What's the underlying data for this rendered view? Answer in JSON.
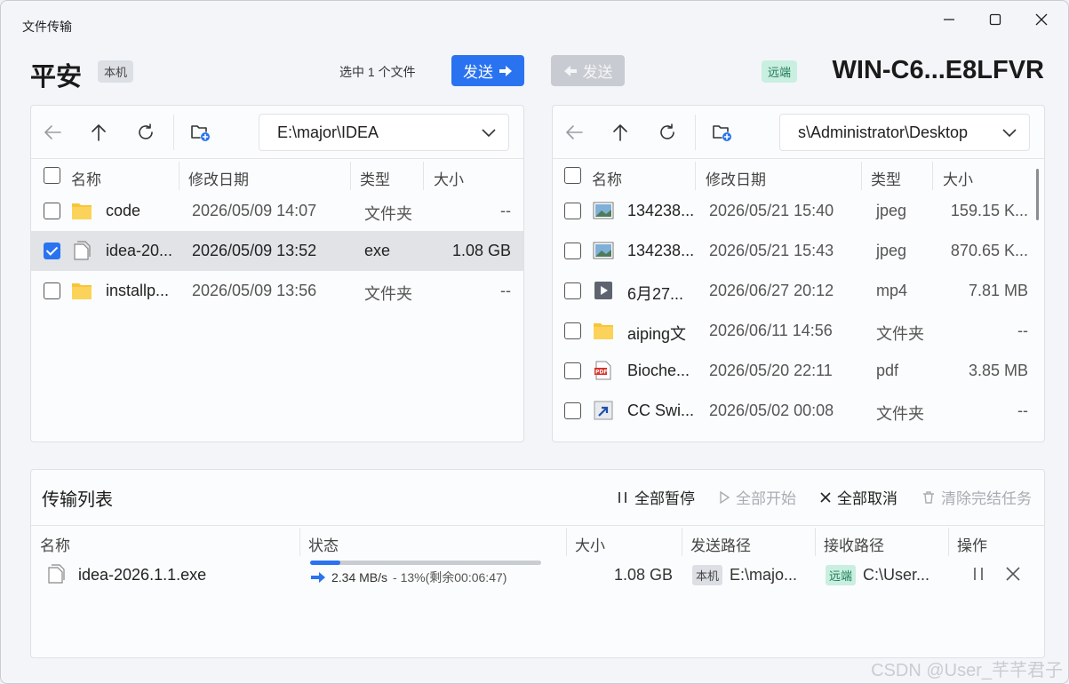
{
  "window": {
    "title": "文件传输"
  },
  "local": {
    "name": "平安",
    "badge": "本机",
    "path": "E:\\major\\IDEA",
    "columns": [
      "名称",
      "修改日期",
      "类型",
      "大小"
    ],
    "files": [
      {
        "name": "code",
        "date": "2026/05/09 14:07",
        "type": "文件夹",
        "size": "--",
        "icon": "folder-icon",
        "checked": false
      },
      {
        "name": "idea-20...",
        "date": "2026/05/09 13:52",
        "type": "exe",
        "size": "1.08 GB",
        "icon": "file-icon",
        "checked": true
      },
      {
        "name": "installp...",
        "date": "2026/05/09 13:56",
        "type": "文件夹",
        "size": "--",
        "icon": "folder-icon",
        "checked": false
      }
    ]
  },
  "header": {
    "selected_text": "选中 1 个文件",
    "send_label": "发送",
    "send_back_label": "发送"
  },
  "remote": {
    "name": "WIN-C6...E8LFVR",
    "badge": "远端",
    "path": "s\\Administrator\\Desktop",
    "columns": [
      "名称",
      "修改日期",
      "类型",
      "大小"
    ],
    "files": [
      {
        "name": "134238...",
        "date": "2026/05/21 15:40",
        "type": "jpeg",
        "size": "159.15 K...",
        "icon": "image-icon"
      },
      {
        "name": "134238...",
        "date": "2026/05/21 15:43",
        "type": "jpeg",
        "size": "870.65 K...",
        "icon": "image-icon"
      },
      {
        "name": "6月27...",
        "date": "2026/06/27 20:12",
        "type": "mp4",
        "size": "7.81 MB",
        "icon": "video-icon"
      },
      {
        "name": "aiping文",
        "date": "2026/06/11 14:56",
        "type": "文件夹",
        "size": "--",
        "icon": "folder-icon"
      },
      {
        "name": "Bioche...",
        "date": "2026/05/20 22:11",
        "type": "pdf",
        "size": "3.85 MB",
        "icon": "pdf-icon"
      },
      {
        "name": "CC Swi...",
        "date": "2026/05/02 00:08",
        "type": "文件夹",
        "size": "--",
        "icon": "shortcut-icon"
      }
    ]
  },
  "transfer": {
    "title": "传输列表",
    "actions": {
      "pause_all": "全部暂停",
      "start_all": "全部开始",
      "cancel_all": "全部取消",
      "clear_done": "清除完结任务"
    },
    "columns": [
      "名称",
      "状态",
      "大小",
      "发送路径",
      "接收路径",
      "操作"
    ],
    "items": [
      {
        "name": "idea-2026.1.1.exe",
        "speed": "2.34 MB/s",
        "progress_text": "- 13%(剩余00:06:47)",
        "progress": 0.13,
        "size": "1.08 GB",
        "send_badge": "本机",
        "send_path": "E:\\majo...",
        "recv_badge": "远端",
        "recv_path": "C:\\User..."
      }
    ]
  },
  "watermark": "CSDN @User_芊芊君子",
  "colors": {
    "accent": "#2a73f0",
    "remote_badge": "#c9efe0",
    "local_badge": "#dcdfe4"
  }
}
